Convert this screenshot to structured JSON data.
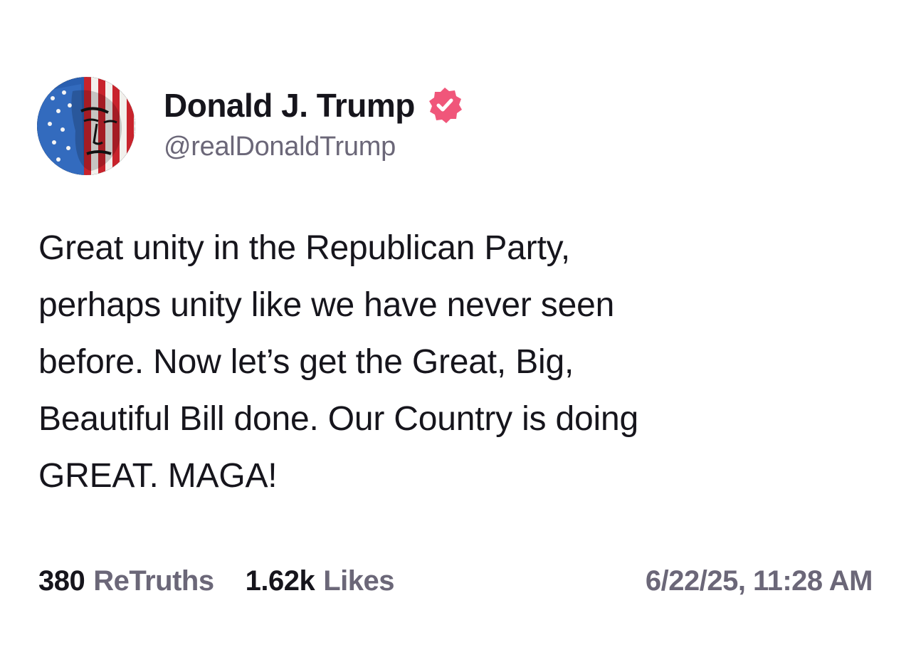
{
  "author": {
    "display_name": "Donald J. Trump",
    "handle": "@realDonaldTrump",
    "verified": true,
    "verified_badge_color": "#f0567a",
    "avatar_icon": "avatar-flag-portrait"
  },
  "post": {
    "text": "Great unity in the Republican Party,\nperhaps unity like we have never seen\nbefore. Now let’s get the Great, Big,\nBeautiful Bill done. Our Country is doing\nGREAT. MAGA!"
  },
  "stats": {
    "retruths_count": "380",
    "retruths_label": "ReTruths",
    "likes_count": "1.62k",
    "likes_label": "Likes"
  },
  "timestamp": "6/22/25, 11:28 AM",
  "colors": {
    "text_primary": "#16151c",
    "text_secondary": "#6b6778",
    "background": "#ffffff"
  }
}
